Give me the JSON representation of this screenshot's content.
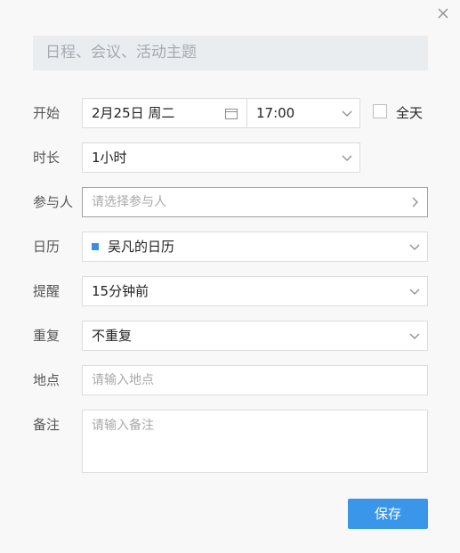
{
  "title_field": {
    "placeholder": "日程、会议、活动主题"
  },
  "start": {
    "label": "开始",
    "date": "2月25日 周二",
    "time": "17:00",
    "all_day_label": "全天",
    "all_day_checked": false
  },
  "duration": {
    "label": "时长",
    "value": "1小时"
  },
  "participants": {
    "label": "参与人",
    "placeholder": "请选择参与人"
  },
  "calendar": {
    "label": "日历",
    "value": "吴凡的日历",
    "color": "#3a8ee6"
  },
  "reminder": {
    "label": "提醒",
    "value": "15分钟前"
  },
  "repeat": {
    "label": "重复",
    "value": "不重复"
  },
  "location": {
    "label": "地点",
    "placeholder": "请输入地点"
  },
  "notes": {
    "label": "备注",
    "placeholder": "请输入备注"
  },
  "actions": {
    "save_label": "保存",
    "accent_color": "#3a96e8"
  },
  "icons": [
    "close-icon",
    "calendar-icon",
    "chevron-down-icon",
    "chevron-right-icon"
  ]
}
